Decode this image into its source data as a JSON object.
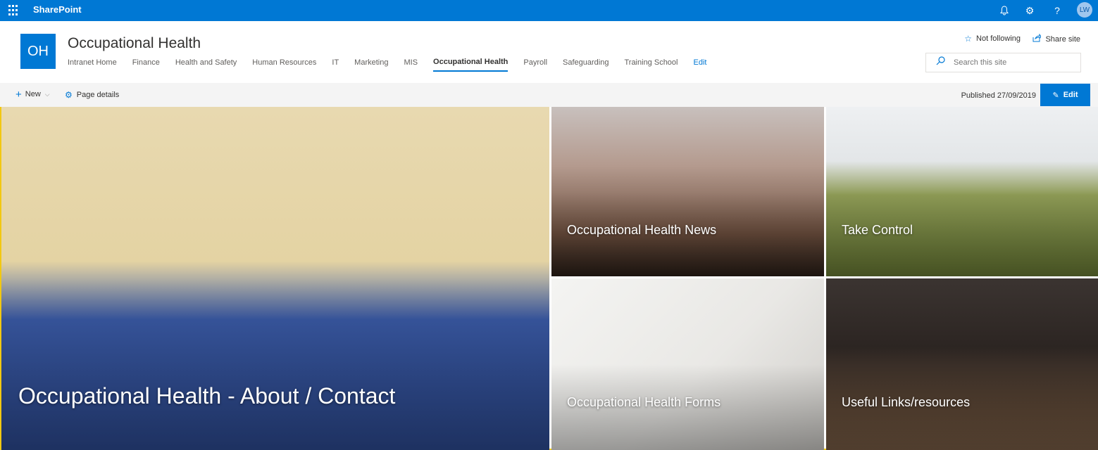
{
  "suite": {
    "app_name": "SharePoint",
    "avatar_initials": "LW",
    "icons": [
      "waffle-icon",
      "bell-icon",
      "gear-icon",
      "help-icon"
    ],
    "brand_color": "#0078d4"
  },
  "site": {
    "logo_initials": "OH",
    "title": "Occupational Health",
    "follow_label": "Not following",
    "share_label": "Share site",
    "search_placeholder": "Search this site"
  },
  "nav": {
    "items": [
      {
        "label": "Intranet Home"
      },
      {
        "label": "Finance"
      },
      {
        "label": "Health and Safety"
      },
      {
        "label": "Human Resources"
      },
      {
        "label": "IT"
      },
      {
        "label": "Marketing"
      },
      {
        "label": "MIS"
      },
      {
        "label": "Occupational Health",
        "active": true
      },
      {
        "label": "Payroll"
      },
      {
        "label": "Safeguarding"
      },
      {
        "label": "Training School"
      }
    ],
    "edit_label": "Edit"
  },
  "commandbar": {
    "new_label": "New",
    "page_details_label": "Page details",
    "published": "Published 27/09/2019",
    "edit_label": "Edit"
  },
  "hero": {
    "main": "Occupational Health - About / Contact",
    "news": "Occupational Health News",
    "control": "Take Control",
    "forms": "Occupational Health Forms",
    "links": "Useful Links/resources"
  }
}
